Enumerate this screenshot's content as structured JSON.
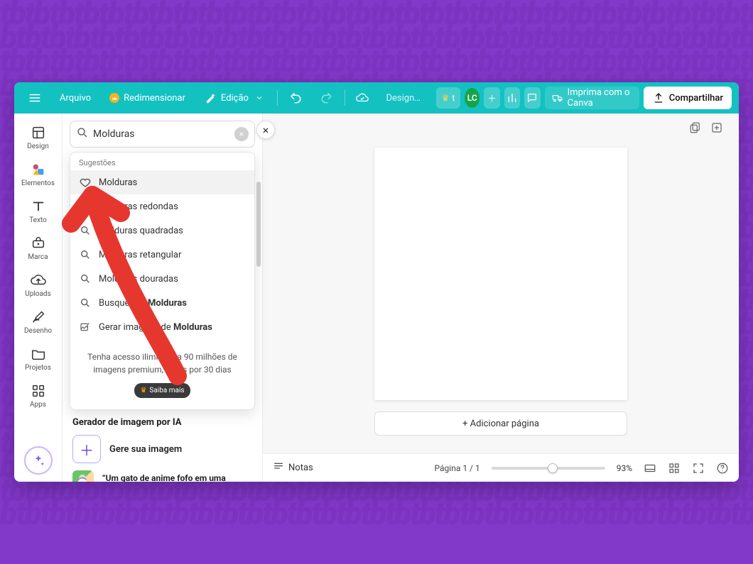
{
  "topbar": {
    "file": "Arquivo",
    "resize": "Redimensionar",
    "edit": "Edição",
    "design_name": "Design se...",
    "try_pro": "t",
    "avatar": "LC",
    "print": "Imprima com o Canva",
    "share": "Compartilhar"
  },
  "rail": [
    {
      "key": "design",
      "label": "Design"
    },
    {
      "key": "elements",
      "label": "Elementos"
    },
    {
      "key": "text",
      "label": "Texto"
    },
    {
      "key": "brand",
      "label": "Marca"
    },
    {
      "key": "uploads",
      "label": "Uploads"
    },
    {
      "key": "draw",
      "label": "Desenho"
    },
    {
      "key": "projects",
      "label": "Projetos"
    },
    {
      "key": "apps",
      "label": "Apps"
    }
  ],
  "search": {
    "value": "Molduras"
  },
  "suggest": {
    "heading": "Sugestões",
    "items": [
      {
        "icon": "heart",
        "label": "Molduras"
      },
      {
        "icon": "search",
        "label": "Molduras redondas"
      },
      {
        "icon": "search",
        "label": "Molduras quadradas"
      },
      {
        "icon": "search",
        "label": "Molduras retangular"
      },
      {
        "icon": "search",
        "label": "Molduras douradas"
      }
    ],
    "search_by_prefix": "Busque por ",
    "search_by_bold": "Molduras",
    "gen_prefix": "Gerar imagens de ",
    "gen_bold": "Molduras",
    "promo_text": "Tenha acesso ilimitado a 90 milhões de imagens premium, grátis por 30 dias",
    "promo_cta": "Saiba mais"
  },
  "panel_rest": {
    "heading": "Gerador de imagem por IA",
    "generate": "Gere sua imagem",
    "sample_quote": "“Um gato de anime fofo em uma floresta com flores”"
  },
  "canvas": {
    "add_page": "+ Adicionar página",
    "notes": "Notas",
    "pager_label": "Página 1 / 1",
    "zoom": "93%"
  }
}
